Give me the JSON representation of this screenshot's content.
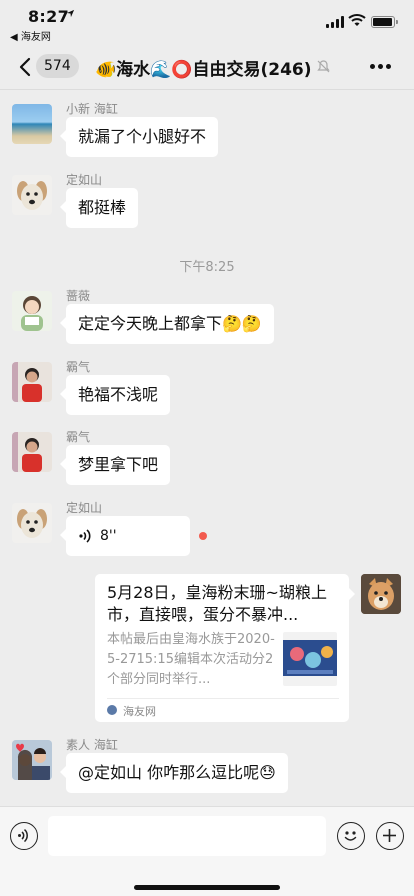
{
  "status_bar": {
    "time": "8:27",
    "back_app": "◀ 海友网"
  },
  "nav": {
    "unread_count": "574",
    "title": "🐠海水🌊⭕自由交易(246)"
  },
  "messages": [
    {
      "sender": "小新 海缸",
      "text": "就漏了个小腿好不"
    },
    {
      "sender": "定如山",
      "text": "都挺棒"
    },
    {
      "sender": "蔷薇",
      "text": "定定今天晚上都拿下🤔🤔"
    },
    {
      "sender": "霸气",
      "text": "艳福不浅呢"
    },
    {
      "sender": "霸气",
      "text": "梦里拿下吧"
    },
    {
      "sender": "定如山",
      "voice_duration": "8''"
    },
    {
      "sender": "素人 海缸",
      "text": "@定如山  你咋那么逗比呢😓"
    }
  ],
  "timestamp": "下午8:25",
  "shared_card": {
    "title": "5月28日，皇海粉末珊~瑚粮上市，直接喂，蛋分不暴冲...",
    "description": "本帖最后由皇海水族于2020-5-2715:15编辑本次活动分2个部分同时举行...",
    "source": "海友网"
  },
  "colors": {
    "background": "#ededed",
    "bubble": "#ffffff",
    "unread_dot": "#f25a4e"
  }
}
